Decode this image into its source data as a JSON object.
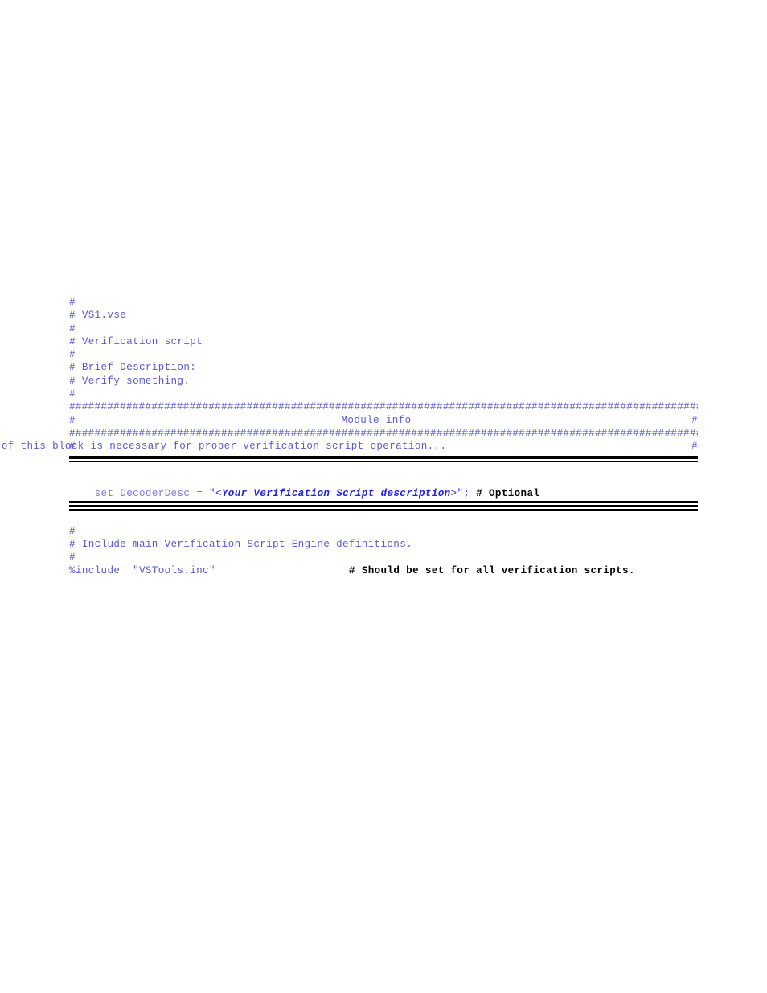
{
  "document": {
    "kind": "source-code-listing",
    "language": "vse",
    "colors": {
      "comment_blue": "#5a5ad2",
      "dim_blue": "#7b7bdd",
      "string_blue": "#2b2bd8",
      "emphasis_blue": "#2222dd",
      "note_black": "#000000",
      "rule_black": "#000000",
      "background": "#ffffff"
    }
  },
  "header_block": {
    "lines": [
      "#",
      "# VS1.vse",
      "#",
      "# Verification script",
      "#",
      "# Brief Description:",
      "# Verify something.",
      "#"
    ]
  },
  "module_info_block": {
    "hash_rule_top": "########################################################################################################",
    "title_line": {
      "left_hash": "#",
      "title": "Module info",
      "right_hash": "#"
    },
    "hash_rule_bottom": "########################################################################################################",
    "note_line": {
      "left_hash": "#",
      "text": "Filling of this block is necessary for proper verification script operation...",
      "right_hash": "#"
    }
  },
  "rules": {
    "top_group": "double-bar-separator",
    "mid_group": "triple-bar-separator"
  },
  "decoder_desc_statement": {
    "keyword": "set",
    "variable": "DecoderDesc",
    "operator": "=",
    "quote_open": "\"<",
    "placeholder": "Your Verification Script description",
    "quote_close": ">\";",
    "comment": "# Optional"
  },
  "include_block": {
    "lines": [
      "#",
      "# Include main Verification Script Engine definitions.",
      "#"
    ],
    "directive": "%include",
    "file": "\"VSTools.inc\"",
    "comment": "# Should be set for all verification scripts."
  }
}
